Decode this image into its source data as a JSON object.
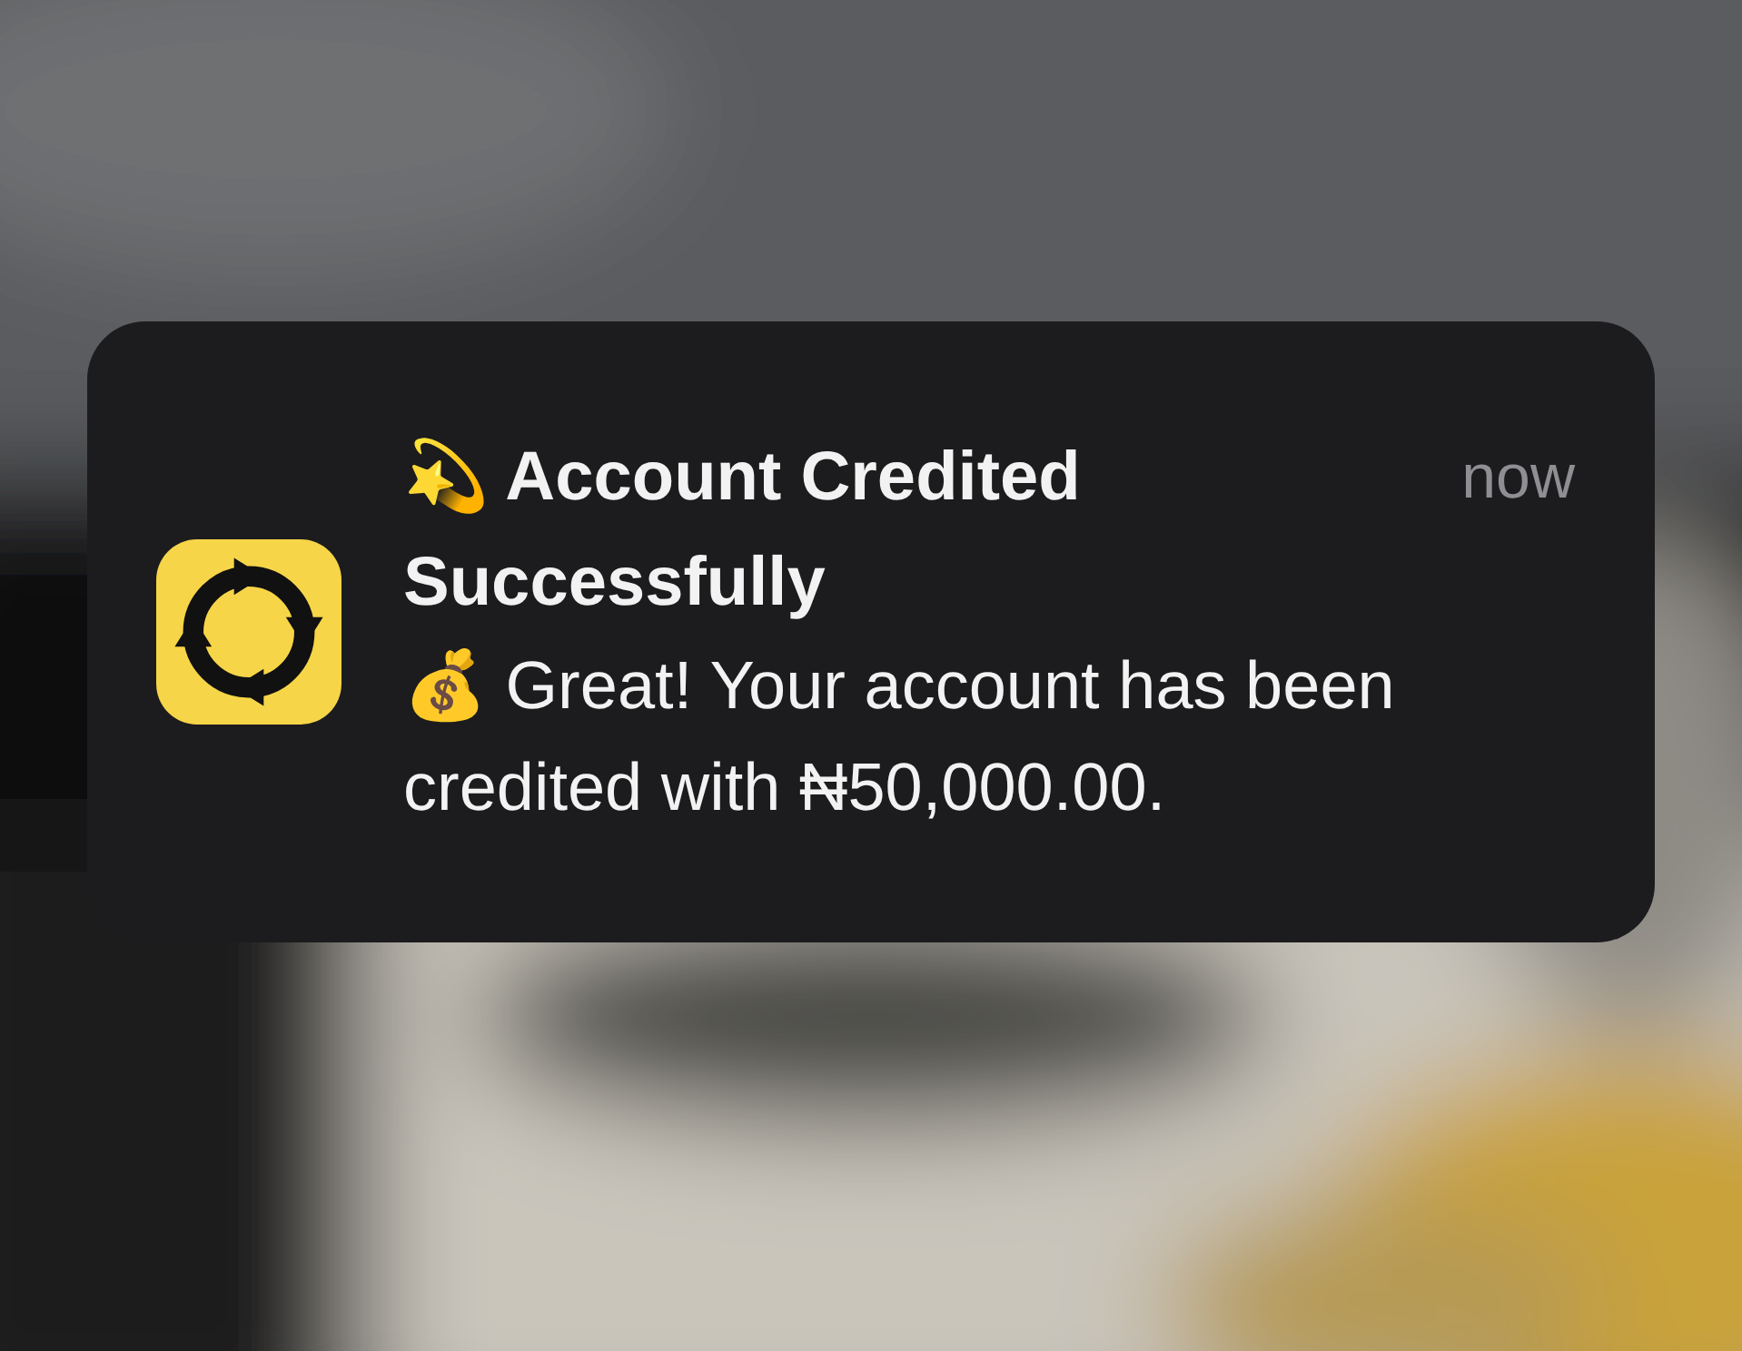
{
  "notification": {
    "title": "💫 Account Credited Successfully",
    "time": "now",
    "body": "💰 Great! Your account has been credited with ₦50,000.00."
  }
}
